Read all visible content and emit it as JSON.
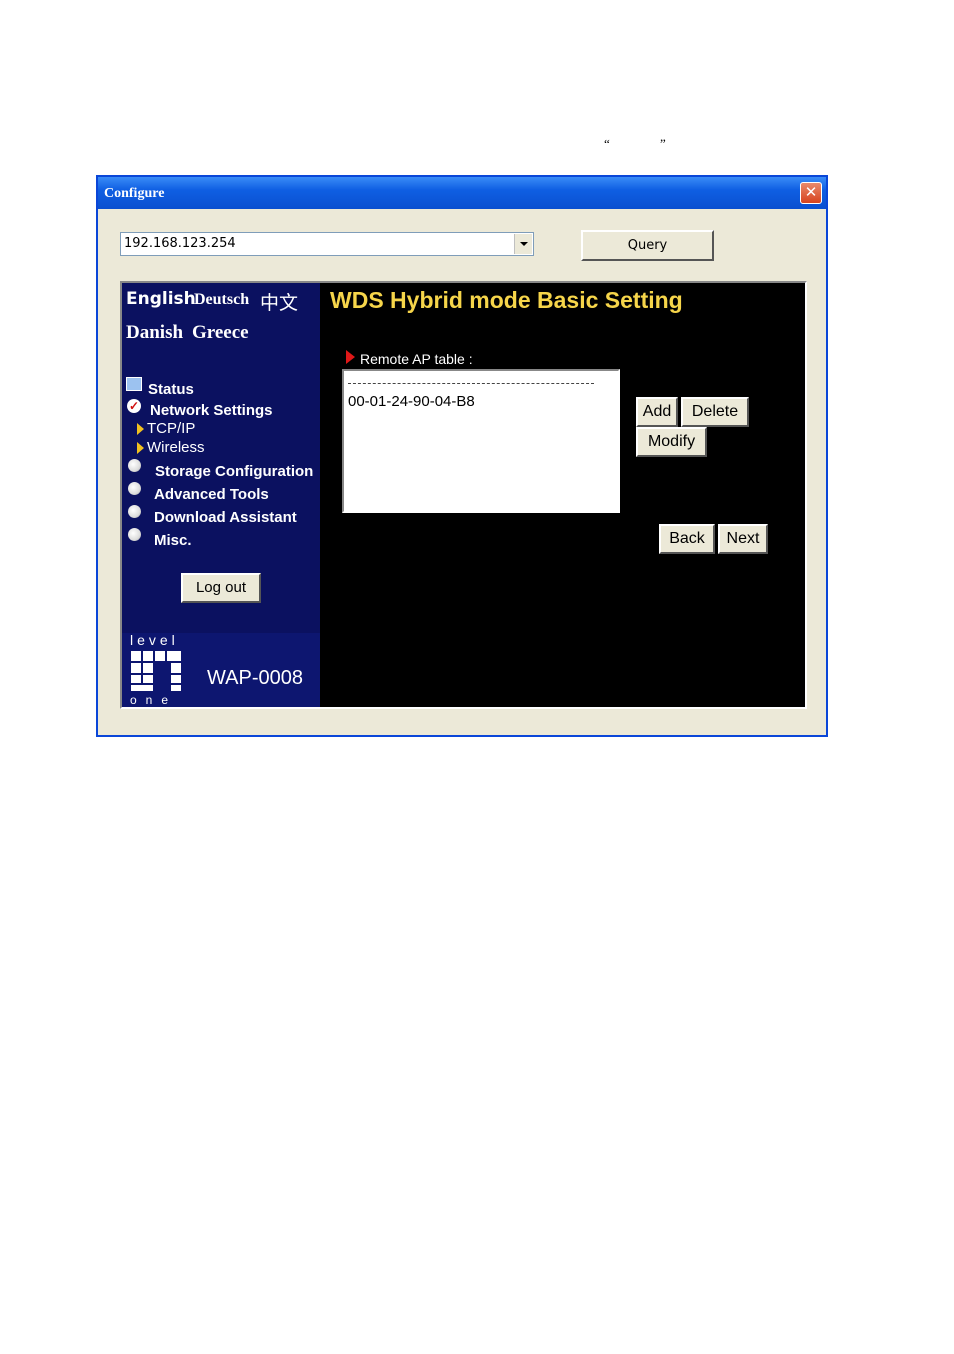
{
  "doc": {
    "open_quote": "“",
    "close_quote": "”"
  },
  "window": {
    "title": "Configure",
    "close_glyph": "✕"
  },
  "toolbar": {
    "address_value": "192.168.123.254",
    "query_label": "Query"
  },
  "sidebar": {
    "languages": [
      "English",
      "Deutsch",
      "中文",
      "Danish",
      "Greece"
    ],
    "nav": {
      "status": "Status",
      "network_settings": "Network Settings",
      "tcpip": "TCP/IP",
      "wireless": "Wireless",
      "storage": "Storage Configuration",
      "advanced": "Advanced Tools",
      "download": "Download Assistant",
      "misc": "Misc."
    },
    "logout_label": "Log out",
    "logo": {
      "top_word": "level",
      "bottom_word": "one",
      "model": "WAP-0008"
    }
  },
  "main": {
    "title": "WDS Hybrid mode Basic Setting",
    "table_label": "Remote AP table :",
    "table_separator": "-----------------------------------------------------",
    "entries": [
      "00-01-24-90-04-B8"
    ],
    "buttons": {
      "add": "Add",
      "delete": "Delete",
      "modify": "Modify",
      "back": "Back",
      "next": "Next"
    }
  },
  "colors": {
    "title_yellow": "#f6d54a",
    "sidebar_navy": "#0b1160",
    "titlebar_blue": "#0a4fd0"
  }
}
